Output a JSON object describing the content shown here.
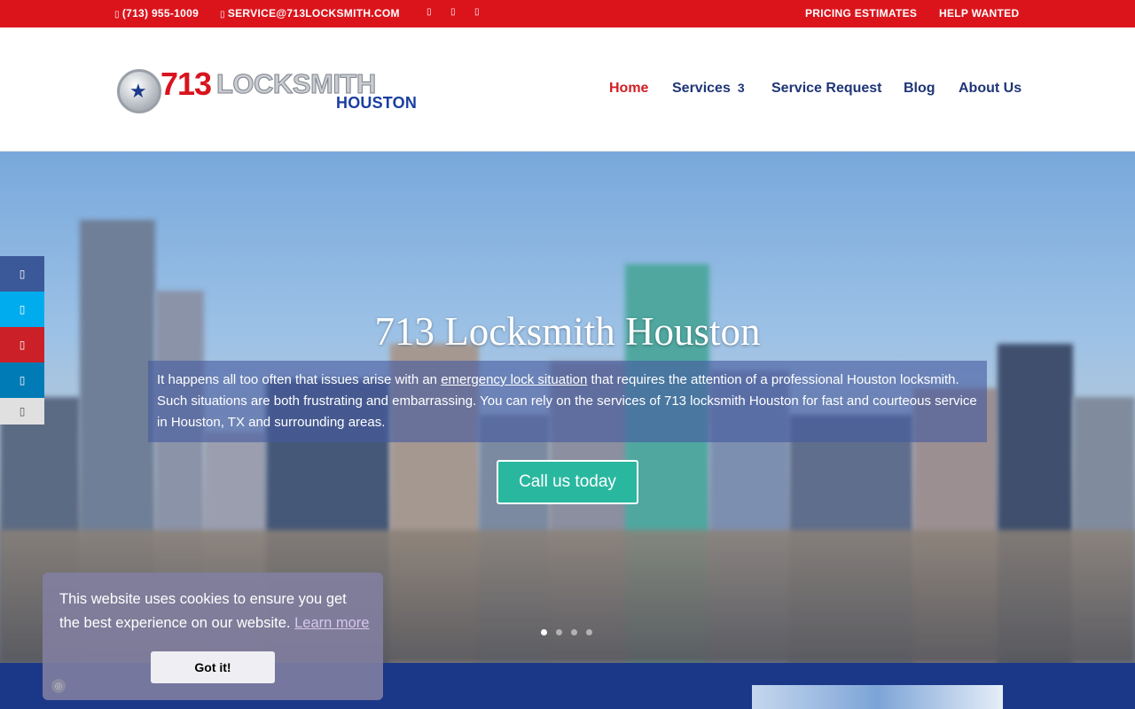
{
  "topbar": {
    "phone": "(713) 955-1009",
    "email": "SERVICE@713LOCKSMITH.COM",
    "phone_icon": "phone-icon",
    "email_icon": "email-icon",
    "social_icons": [
      "facebook-icon",
      "twitter-icon",
      "google-plus-icon"
    ],
    "links": [
      "PRICING ESTIMATES",
      "HELP WANTED"
    ],
    "color": "#db141c"
  },
  "header": {
    "logo": {
      "number": "713",
      "word": "LOCKSMITH",
      "city": "HOUSTON"
    },
    "nav": [
      {
        "label": "Home",
        "active": true
      },
      {
        "label": "Services",
        "chevron": "3"
      },
      {
        "label": "Service Request"
      },
      {
        "label": "Blog"
      },
      {
        "label": "About Us"
      }
    ],
    "active_color": "#d11f25",
    "nav_color": "#1f3577"
  },
  "hero": {
    "title": "713 Locksmith Houston",
    "text_before": "It happens all too often that issues arise with an ",
    "text_link": "emergency lock situation",
    "text_after": " that requires the attention of a professional Houston locksmith. Such situations are both frustrating and embarrassing. You can rely on the services of 713 locksmith Houston for fast and courteous service in Houston, TX and surrounding areas.",
    "cta": "Call us today",
    "cta_color": "#2ab7a0",
    "slides": 4,
    "active_slide": 1
  },
  "side_share": [
    {
      "icon": "facebook-icon",
      "color": "#3b5998"
    },
    {
      "icon": "twitter-icon",
      "color": "#00aced"
    },
    {
      "icon": "pinterest-icon",
      "color": "#cb2027"
    },
    {
      "icon": "linkedin-icon",
      "color": "#007bb6"
    },
    {
      "icon": "more-icon",
      "color": "#e0e0e0"
    }
  ],
  "cookie": {
    "text": "This website uses cookies to ensure you get the best experience on our website.",
    "link": "Learn more",
    "button": "Got it!"
  },
  "glyphs": {
    "phone": "▯",
    "email": "▯",
    "social": "▯",
    "cookie": "◎"
  }
}
